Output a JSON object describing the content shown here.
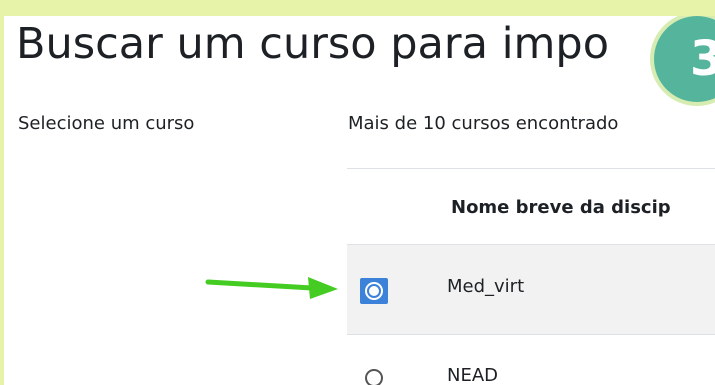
{
  "page": {
    "title": "Buscar um curso para impo"
  },
  "step_badge": {
    "label": "3",
    "color": "#55b59c"
  },
  "form": {
    "select_label": "Selecione um curso",
    "results_count": "Mais de 10 cursos encontrado"
  },
  "table": {
    "column_header": "Nome breve da discip",
    "rows": [
      {
        "name": "Med_virt",
        "selected": true
      },
      {
        "name": "NEAD",
        "selected": false
      }
    ]
  },
  "annotation": {
    "arrow_color": "#44cc22",
    "highlight_color": "#e6f3a8",
    "selected_radio_color": "#3b82d8"
  }
}
